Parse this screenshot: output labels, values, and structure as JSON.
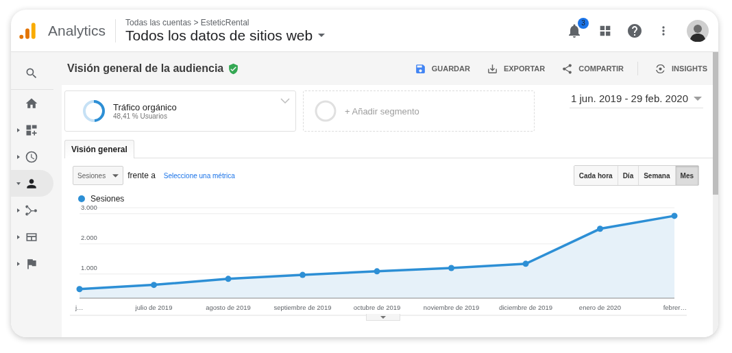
{
  "header": {
    "product": "Analytics",
    "breadcrumb": "Todas las cuentas > EsteticRental",
    "view": "Todos los datos de sitios web",
    "notifications": "3"
  },
  "sidebar": {
    "items": [
      {
        "kind": "search",
        "selected": false
      },
      {
        "kind": "home",
        "selected": false
      },
      {
        "kind": "dashboards",
        "selected": false,
        "expanded": false
      },
      {
        "kind": "realtime",
        "selected": false,
        "expanded": false
      },
      {
        "kind": "audience",
        "selected": true,
        "expanded": true
      },
      {
        "kind": "acquisition",
        "selected": false,
        "expanded": false
      },
      {
        "kind": "behavior",
        "selected": false,
        "expanded": false
      },
      {
        "kind": "conversions",
        "selected": false,
        "expanded": false
      }
    ]
  },
  "report": {
    "title": "Visión general de la audiencia",
    "actions": [
      {
        "kind": "save",
        "label": "GUARDAR"
      },
      {
        "kind": "export",
        "label": "EXPORTAR"
      },
      {
        "kind": "share",
        "label": "COMPARTIR"
      },
      {
        "kind": "insights",
        "label": "INSIGHTS"
      }
    ],
    "segments": [
      {
        "kind": "segment",
        "name": "Tráfico orgánico",
        "detail": "48,41 % Usuarios",
        "level": 0.4841
      },
      {
        "kind": "add",
        "label": "+ Añadir segmento"
      }
    ],
    "date_range": "1 jun. 2019 - 29 feb. 2020",
    "tabs": [
      {
        "label": "Visión general",
        "selected": true
      }
    ],
    "metric": "Sesiones",
    "versus": "frente a",
    "metric_link": "Seleccione una métrica",
    "granularity": [
      {
        "label": "Cada hora",
        "selected": false
      },
      {
        "label": "Día",
        "selected": false
      },
      {
        "label": "Semana",
        "selected": false
      },
      {
        "label": "Mes",
        "selected": true
      }
    ],
    "chart_data": {
      "type": "area",
      "categories": [
        "j…",
        "julio de 2019",
        "agosto de 2019",
        "septiembre de 2019",
        "octubre de 2019",
        "noviembre de 2019",
        "diciembre de 2019",
        "enero de 2020",
        "febrer…"
      ],
      "series": [
        {
          "name": "Sesiones",
          "color": "#2d8fd5",
          "values": [
            500,
            640,
            840,
            970,
            1090,
            1200,
            1340,
            2500,
            2930
          ]
        }
      ],
      "ylim": [
        200,
        3200
      ],
      "grid": true,
      "yticks": [
        {
          "value": 1000,
          "label": "1.000"
        },
        {
          "value": 2000,
          "label": "2.000"
        },
        {
          "value": 3000,
          "label": "3.000"
        }
      ]
    }
  }
}
